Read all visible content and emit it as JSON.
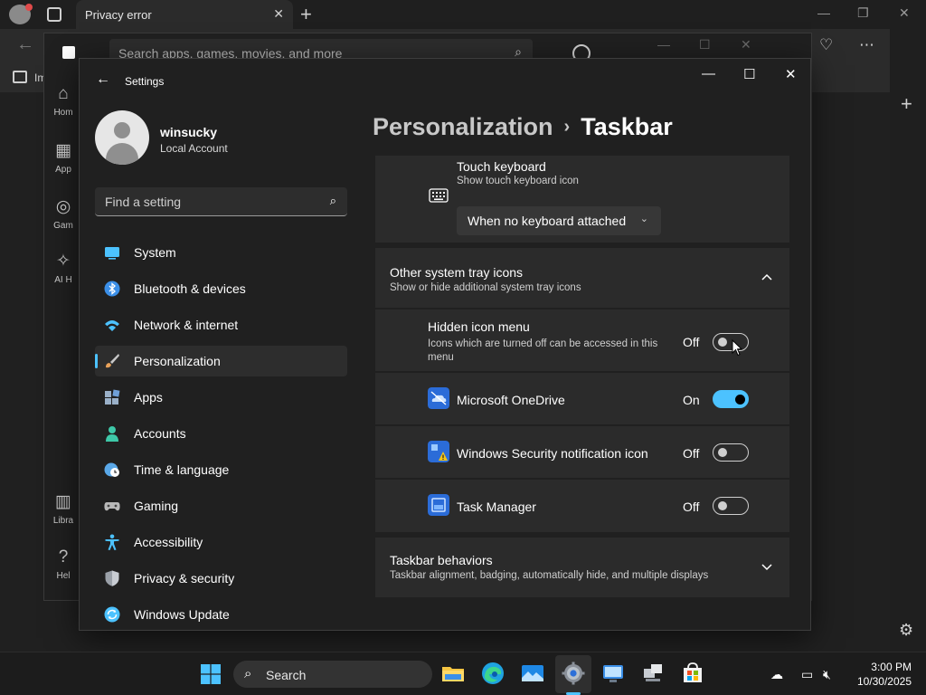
{
  "browser": {
    "tab_title": "Privacy error",
    "favorites_label": "Im"
  },
  "store": {
    "search_placeholder": "Search apps, games, movies, and more",
    "nav": [
      {
        "label": "Hom",
        "icon": "home-icon"
      },
      {
        "label": "App",
        "icon": "apps-icon"
      },
      {
        "label": "Gam",
        "icon": "gaming-icon"
      },
      {
        "label": "AI H",
        "icon": "ai-hub-icon"
      },
      {
        "label": "Libra",
        "icon": "library-icon"
      },
      {
        "label": "Hel",
        "icon": "help-icon"
      }
    ]
  },
  "settings": {
    "window_title": "Settings",
    "user": {
      "name": "winsucky",
      "account_type": "Local Account"
    },
    "search_placeholder": "Find a setting",
    "nav": [
      {
        "label": "System",
        "icon": "system-icon",
        "color": "#4cc2ff"
      },
      {
        "label": "Bluetooth & devices",
        "icon": "bluetooth-icon",
        "color": "#3b8fe8"
      },
      {
        "label": "Network & internet",
        "icon": "wifi-icon",
        "color": "#4cc2ff"
      },
      {
        "label": "Personalization",
        "icon": "brush-icon",
        "color": "#e8a25a",
        "active": true
      },
      {
        "label": "Apps",
        "icon": "apps-icon",
        "color": "#9ab0c8"
      },
      {
        "label": "Accounts",
        "icon": "person-icon",
        "color": "#3ec8a8"
      },
      {
        "label": "Time & language",
        "icon": "globe-clock-icon",
        "color": "#5aa8e8"
      },
      {
        "label": "Gaming",
        "icon": "controller-icon",
        "color": "#b8b8b8"
      },
      {
        "label": "Accessibility",
        "icon": "accessibility-icon",
        "color": "#4cc2ff"
      },
      {
        "label": "Privacy & security",
        "icon": "shield-icon",
        "color": "#9aa0a8"
      },
      {
        "label": "Windows Update",
        "icon": "update-icon",
        "color": "#4cc2ff"
      }
    ],
    "breadcrumb": {
      "parent": "Personalization",
      "separator": "›",
      "current": "Taskbar"
    },
    "touch_keyboard": {
      "title": "Touch keyboard",
      "subtitle": "Show touch keyboard icon",
      "dropdown_value": "When no keyboard attached"
    },
    "tray_section": {
      "title": "Other system tray icons",
      "subtitle": "Show or hide additional system tray icons",
      "expanded": true
    },
    "tray_items": [
      {
        "label": "Hidden icon menu",
        "description": "Icons which are turned off can be accessed in this menu",
        "state": "Off",
        "on": false
      },
      {
        "label": "Microsoft OneDrive",
        "state": "On",
        "on": true,
        "icon": "onedrive-icon"
      },
      {
        "label": "Windows Security notification icon",
        "state": "Off",
        "on": false,
        "icon": "windows-security-icon"
      },
      {
        "label": "Task Manager",
        "state": "Off",
        "on": false,
        "icon": "task-manager-icon"
      }
    ],
    "behaviors": {
      "title": "Taskbar behaviors",
      "subtitle": "Taskbar alignment, badging, automatically hide, and multiple displays"
    }
  },
  "taskbar": {
    "search_label": "Search",
    "time": "3:00 PM",
    "date": "10/30/2025"
  },
  "colors": {
    "accent": "#4cc2ff",
    "card": "#2b2b2b",
    "window": "#202020"
  }
}
